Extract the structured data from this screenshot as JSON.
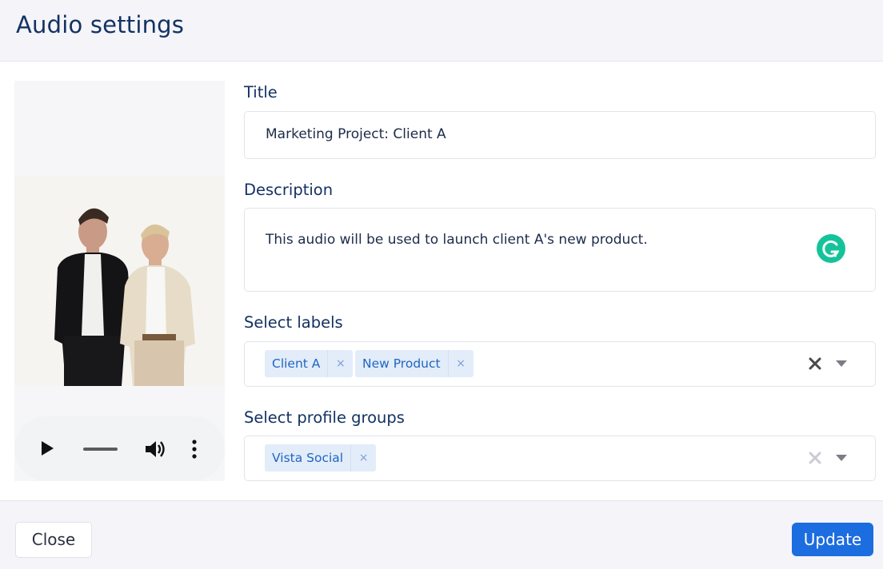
{
  "dialog": {
    "title": "Audio settings"
  },
  "form": {
    "title_label": "Title",
    "title_value": "Marketing Project: Client A",
    "description_label": "Description",
    "description_value": "This audio will be used to launch client A's new product.",
    "labels_label": "Select labels",
    "labels_tags": [
      {
        "label": "Client A",
        "remove": "×"
      },
      {
        "label": "New Product",
        "remove": "×"
      }
    ],
    "groups_label": "Select profile groups",
    "groups_tags": [
      {
        "label": "Vista Social",
        "remove": "×"
      }
    ]
  },
  "media": {
    "player_icons": [
      "play-icon",
      "volume-icon",
      "more-vertical-icon"
    ]
  },
  "footer": {
    "close_label": "Close",
    "update_label": "Update"
  },
  "colors": {
    "accent": "#1c6de0",
    "tag_bg": "#e3ecf9",
    "tag_text": "#1f66c1",
    "grammarly": "#15c39a",
    "heading": "#133262"
  }
}
